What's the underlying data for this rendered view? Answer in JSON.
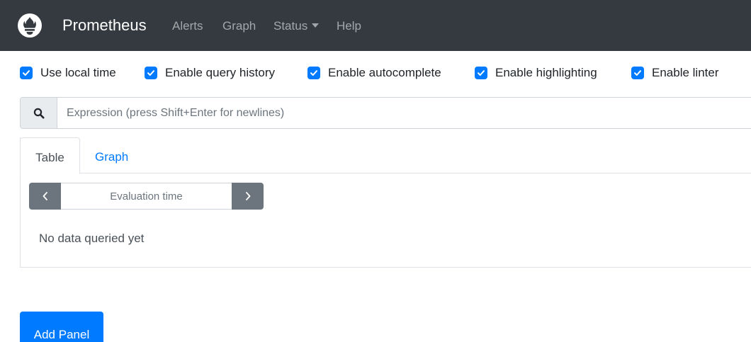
{
  "navbar": {
    "brand": "Prometheus",
    "links": {
      "alerts": "Alerts",
      "graph": "Graph",
      "status": "Status",
      "help": "Help"
    },
    "icons": {
      "logo": "prometheus-flame-logo",
      "status_caret": "caret-down-icon"
    },
    "colors": {
      "background": "#343a40",
      "link": "rgba(255,255,255,0.55)",
      "brand": "#ffffff"
    }
  },
  "options": [
    {
      "label": "Use local time",
      "checked": true
    },
    {
      "label": "Enable query history",
      "checked": true
    },
    {
      "label": "Enable autocomplete",
      "checked": true
    },
    {
      "label": "Enable highlighting",
      "checked": true
    },
    {
      "label": "Enable linter",
      "checked": true
    }
  ],
  "expression": {
    "placeholder": "Expression (press Shift+Enter for newlines)",
    "value": "",
    "icon": "search-icon"
  },
  "panel": {
    "tabs": {
      "table": "Table",
      "graph": "Graph",
      "active": "Table"
    },
    "evaluation": {
      "placeholder": "Evaluation time",
      "prev_icon": "chevron-left-icon",
      "next_icon": "chevron-right-icon"
    },
    "status_text": "No data queried yet"
  },
  "add_panel": {
    "label": "Add Panel"
  },
  "colors": {
    "accent": "#007bff",
    "secondary": "#6c757d",
    "border": "#dee2e6"
  }
}
